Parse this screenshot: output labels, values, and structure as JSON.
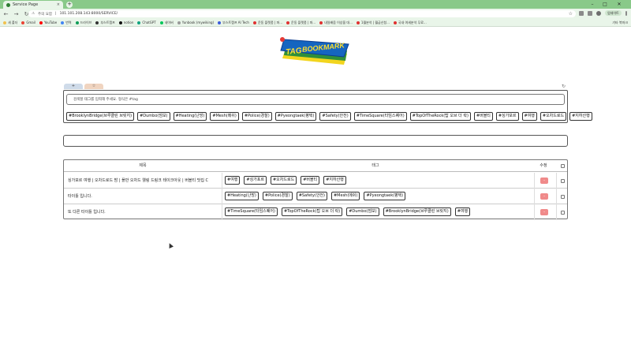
{
  "browser": {
    "tab_title": "Service Page",
    "tab_close": "×",
    "new_tab": "+",
    "url_prefix": "주의 요함",
    "url": "101.101.208.143:8000/SERVICE/",
    "profile_label": "업데이트",
    "bookmarks": [
      {
        "label": "새 폴더",
        "color": "#f2c14e"
      },
      {
        "label": "Gmail",
        "color": "#ea4335"
      },
      {
        "label": "YouTube",
        "color": "#ff0000"
      },
      {
        "label": "번역",
        "color": "#4285f4"
      },
      {
        "label": "드라이브",
        "color": "#0f9d58"
      },
      {
        "label": "부스트캠프",
        "color": "#333333"
      },
      {
        "label": "notion",
        "color": "#111111"
      },
      {
        "label": "ChatGPT",
        "color": "#10a37f"
      },
      {
        "label": "네이버",
        "color": "#03c75a"
      },
      {
        "label": "Yunbook (mywiking)",
        "color": "#999999"
      },
      {
        "label": "부스트캠프 AI Tech",
        "color": "#3b5bdb"
      },
      {
        "label": "운동 플랫폼 | 파...",
        "color": "#e03131"
      },
      {
        "label": "운동 플랫폼 | 파...",
        "color": "#e03131"
      },
      {
        "label": "내일배움 이상을 대...",
        "color": "#e03131"
      },
      {
        "label": "1월분석 | 월급신청...",
        "color": "#e03131"
      },
      {
        "label": "국내 여세분석 무료...",
        "color": "#e03131"
      }
    ],
    "bookmarks_all": "기타 북마크"
  },
  "logo": {
    "line1": "TAG",
    "line2": "BOOKMARK",
    "sub": "the"
  },
  "mode_tabs": [
    "+",
    "☆"
  ],
  "search": {
    "placeholder": "검색할 태그를 입력해 주세요. 형식은 #tag",
    "tags": [
      "#BrooklynBridge(브루클린 브릿지)",
      "#Dumbo(덤보)",
      "#Heating(난방)",
      "#Mesh(메쉬)",
      "#Police(경찰)",
      "#Pyeongtaek(평택)",
      "#Safety(안전)",
      "#TimeSquare(타임스퀘어)",
      "#TopOfTheRock(탑 오브 더 락)",
      "#버블티",
      "#싱가포르",
      "#여행",
      "#오차드로드",
      "#지하산행"
    ]
  },
  "table": {
    "headers": {
      "title": "제목",
      "tags": "태그",
      "edit": "수정"
    },
    "rows": [
      {
        "title": "싱가포르 여행 | 오차드로드 밤 | 플만 오차드 웰링 드링크 테이크아웃 | 버블티 맛집 C",
        "tags": [
          "#여행",
          "#싱가포르",
          "#오차드로드",
          "#버블티",
          "#지하산행"
        ],
        "edit": "-"
      },
      {
        "title": "타이틀 입니다.",
        "tags": [
          "#Heating(난방)",
          "#Police(경찰)",
          "#Safety(안전)",
          "#Mesh(메쉬)",
          "#Pyeongtaek(평택)"
        ],
        "edit": "-"
      },
      {
        "title": "또 다른 타이틀 입니다.",
        "tags": [
          "#TimeSquare(타임스퀘어)",
          "#TopOfTheRock(탑 오브 더 락)",
          "#Dumbo(덤보)",
          "#BrooklynBridge(브루클린 브릿지)",
          "#여행"
        ],
        "edit": "-"
      }
    ]
  }
}
